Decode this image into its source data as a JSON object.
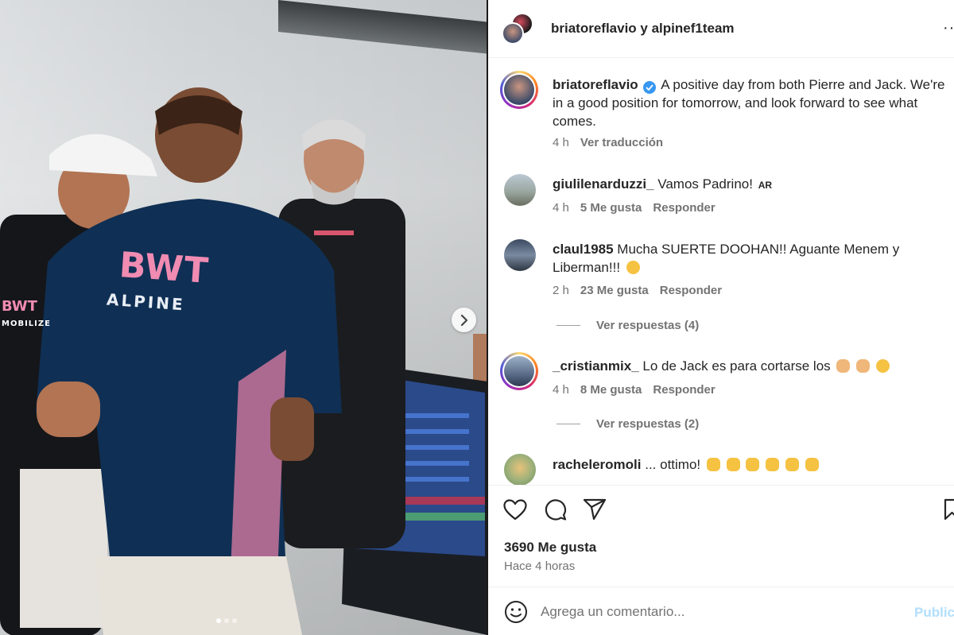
{
  "header": {
    "title": "briatoreflavio y alpinef1team",
    "more_label": "···"
  },
  "photo": {
    "jersey_logo": "BWT",
    "jersey_sub": "ALPINE",
    "sleeve_text": "BWT",
    "sleeve_sub": "MOBILIZE"
  },
  "caption": {
    "user": "briatoreflavio",
    "text": "A positive day from both Pierre and Jack. We're in a good position for tomorrow, and look forward to see what comes.",
    "time": "4 h",
    "translate": "Ver traducción"
  },
  "comments": [
    {
      "user": "giulilenarduzzi_",
      "text": "Vamos Padrino!",
      "tag": "AR",
      "time": "4 h",
      "likes": "5 Me gusta",
      "reply": "Responder"
    },
    {
      "user": "claul1985",
      "text": "Mucha SUERTE DOOHAN!! Aguante Menem y Liberman!!!",
      "time": "2 h",
      "likes": "23 Me gusta",
      "reply": "Responder",
      "replies": "Ver respuestas (4)"
    },
    {
      "user": "_cristianmix_",
      "text": "Lo de Jack es para cortarse los",
      "time": "4 h",
      "likes": "8 Me gusta",
      "reply": "Responder",
      "replies": "Ver respuestas (2)"
    },
    {
      "user": "racheleromoli",
      "text": "... ottimo!"
    }
  ],
  "footer": {
    "likes": "3690 Me gusta",
    "time": "Hace 4 horas",
    "comment_placeholder": "Agrega un comentario...",
    "publish": "Publicar"
  },
  "colors": {
    "verified": "#3897f0",
    "muted": "#737373",
    "publish_disabled": "#b2dffc"
  },
  "icons": [
    "heart-icon",
    "comment-icon",
    "share-icon",
    "bookmark-icon",
    "emoji-icon",
    "chevron-right-icon",
    "verified-icon"
  ]
}
